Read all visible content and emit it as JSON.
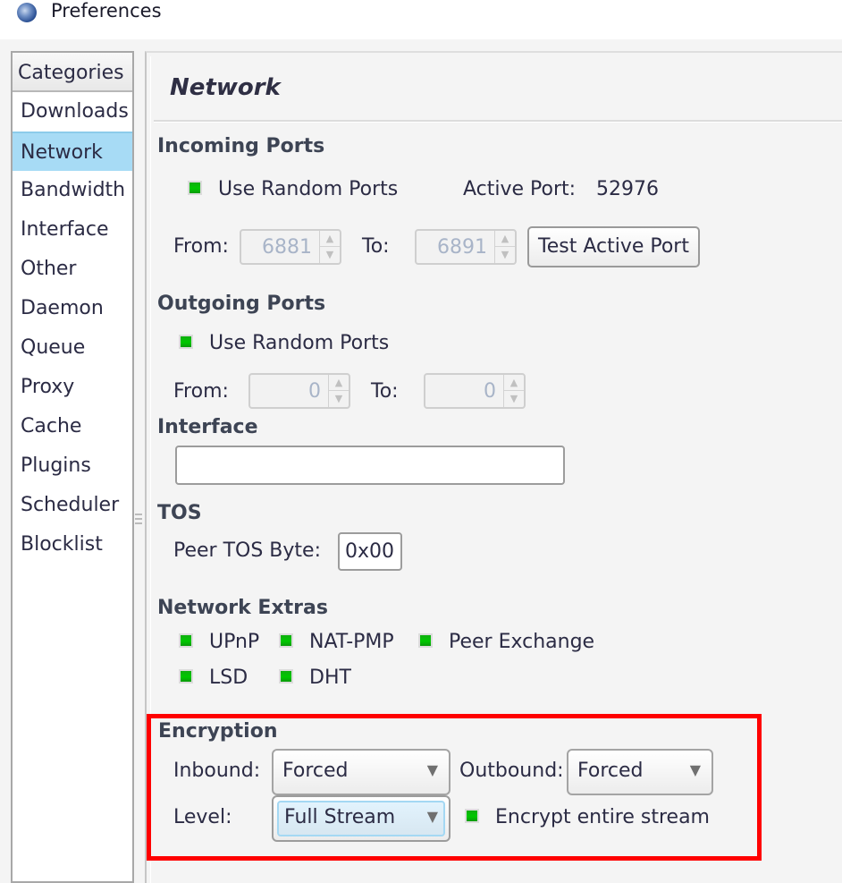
{
  "window": {
    "title": "Preferences",
    "icon": "app-icon"
  },
  "sidebar": {
    "header": "Categories",
    "selected": "Network",
    "items": [
      {
        "label": "Downloads"
      },
      {
        "label": "Network"
      },
      {
        "label": "Bandwidth"
      },
      {
        "label": "Interface"
      },
      {
        "label": "Other"
      },
      {
        "label": "Daemon"
      },
      {
        "label": "Queue"
      },
      {
        "label": "Proxy"
      },
      {
        "label": "Cache"
      },
      {
        "label": "Plugins"
      },
      {
        "label": "Scheduler"
      },
      {
        "label": "Blocklist"
      }
    ]
  },
  "page": {
    "title": "Network",
    "incoming_ports": {
      "heading": "Incoming Ports",
      "use_random_label": "Use Random Ports",
      "use_random_checked": true,
      "active_port_label": "Active Port:",
      "active_port_value": "52976",
      "from_label": "From:",
      "from_value": "6881",
      "to_label": "To:",
      "to_value": "6891",
      "test_button": "Test Active Port"
    },
    "outgoing_ports": {
      "heading": "Outgoing Ports",
      "use_random_label": "Use Random Ports",
      "use_random_checked": true,
      "from_label": "From:",
      "from_value": "0",
      "to_label": "To:",
      "to_value": "0"
    },
    "interface": {
      "heading": "Interface",
      "value": ""
    },
    "tos": {
      "heading": "TOS",
      "peer_tos_label": "Peer TOS Byte:",
      "peer_tos_value": "0x00"
    },
    "network_extras": {
      "heading": "Network Extras",
      "options": [
        {
          "label": "UPnP",
          "checked": true
        },
        {
          "label": "NAT-PMP",
          "checked": true
        },
        {
          "label": "Peer Exchange",
          "checked": true
        },
        {
          "label": "LSD",
          "checked": true
        },
        {
          "label": "DHT",
          "checked": true
        }
      ]
    },
    "encryption": {
      "heading": "Encryption",
      "inbound_label": "Inbound:",
      "inbound_value": "Forced",
      "outbound_label": "Outbound:",
      "outbound_value": "Forced",
      "level_label": "Level:",
      "level_value": "Full Stream",
      "encrypt_entire_label": "Encrypt entire stream",
      "encrypt_entire_checked": true
    }
  },
  "colors": {
    "checkbox_green": "#00c000",
    "selection_blue": "#a7dbf5",
    "highlight_red": "#ff0000"
  }
}
